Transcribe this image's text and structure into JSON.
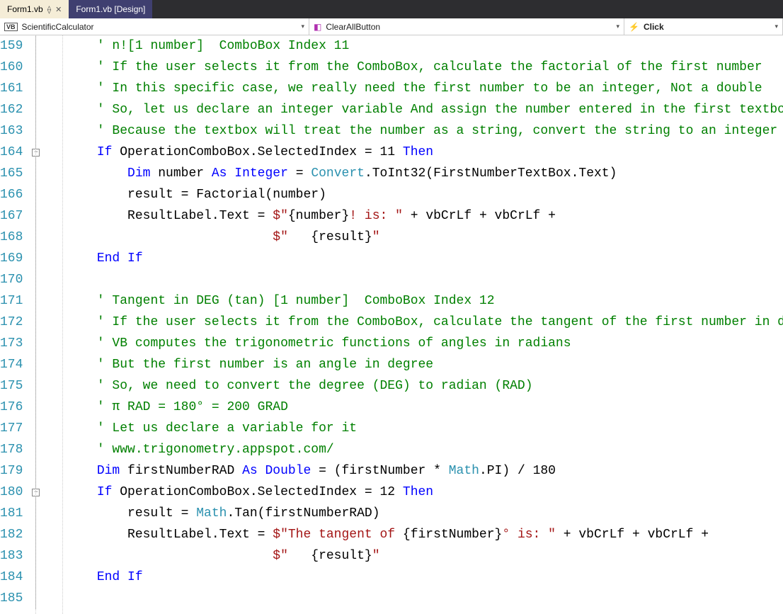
{
  "tabs": [
    {
      "label": "Form1.vb",
      "active": true
    },
    {
      "label": "Form1.vb [Design]",
      "active": false
    }
  ],
  "nav": {
    "project": "ScientificCalculator",
    "object": "ClearAllButton",
    "event": "Click"
  },
  "lines": {
    "start": 159,
    "end": 185
  },
  "code": [
    {
      "type": "comment",
      "indent": 2,
      "text": "' n![1 number]  ComboBox Index 11"
    },
    {
      "type": "comment",
      "indent": 2,
      "text": "' If the user selects it from the ComboBox, calculate the factorial of the first number"
    },
    {
      "type": "comment",
      "indent": 2,
      "text": "' In this specific case, we really need the first number to be an integer, Not a double"
    },
    {
      "type": "comment",
      "indent": 2,
      "text": "' So, let us declare an integer variable And assign the number entered in the first textbox to it"
    },
    {
      "type": "comment",
      "indent": 2,
      "text": "' Because the textbox will treat the number as a string, convert the string to an integer"
    },
    {
      "type": "if11",
      "indent": 2,
      "fold": true
    },
    {
      "type": "dim_number",
      "indent": 3
    },
    {
      "type": "result_factorial",
      "indent": 3
    },
    {
      "type": "resultlabel_1",
      "indent": 3
    },
    {
      "type": "resultlabel_2",
      "indent": 3
    },
    {
      "type": "endif",
      "indent": 2
    },
    {
      "type": "blank",
      "indent": 0
    },
    {
      "type": "comment",
      "indent": 2,
      "text": "' Tangent in DEG (tan) [1 number]  ComboBox Index 12"
    },
    {
      "type": "comment",
      "indent": 2,
      "text": "' If the user selects it from the ComboBox, calculate the tangent of the first number in degrees"
    },
    {
      "type": "comment",
      "indent": 2,
      "text": "' VB computes the trigonometric functions of angles in radians"
    },
    {
      "type": "comment",
      "indent": 2,
      "text": "' But the first number is an angle in degree"
    },
    {
      "type": "comment",
      "indent": 2,
      "text": "' So, we need to convert the degree (DEG) to radian (RAD)"
    },
    {
      "type": "comment",
      "indent": 2,
      "text": "' π RAD = 180° = 200 GRAD"
    },
    {
      "type": "comment",
      "indent": 2,
      "text": "' Let us declare a variable for it"
    },
    {
      "type": "comment",
      "indent": 2,
      "text": "' www.trigonometry.appspot.com/"
    },
    {
      "type": "dim_rad",
      "indent": 2
    },
    {
      "type": "if12",
      "indent": 2,
      "fold": true
    },
    {
      "type": "result_tan",
      "indent": 3
    },
    {
      "type": "resultlabel_3",
      "indent": 3
    },
    {
      "type": "resultlabel_4",
      "indent": 3
    },
    {
      "type": "endif",
      "indent": 2
    },
    {
      "type": "blank",
      "indent": 0
    }
  ]
}
